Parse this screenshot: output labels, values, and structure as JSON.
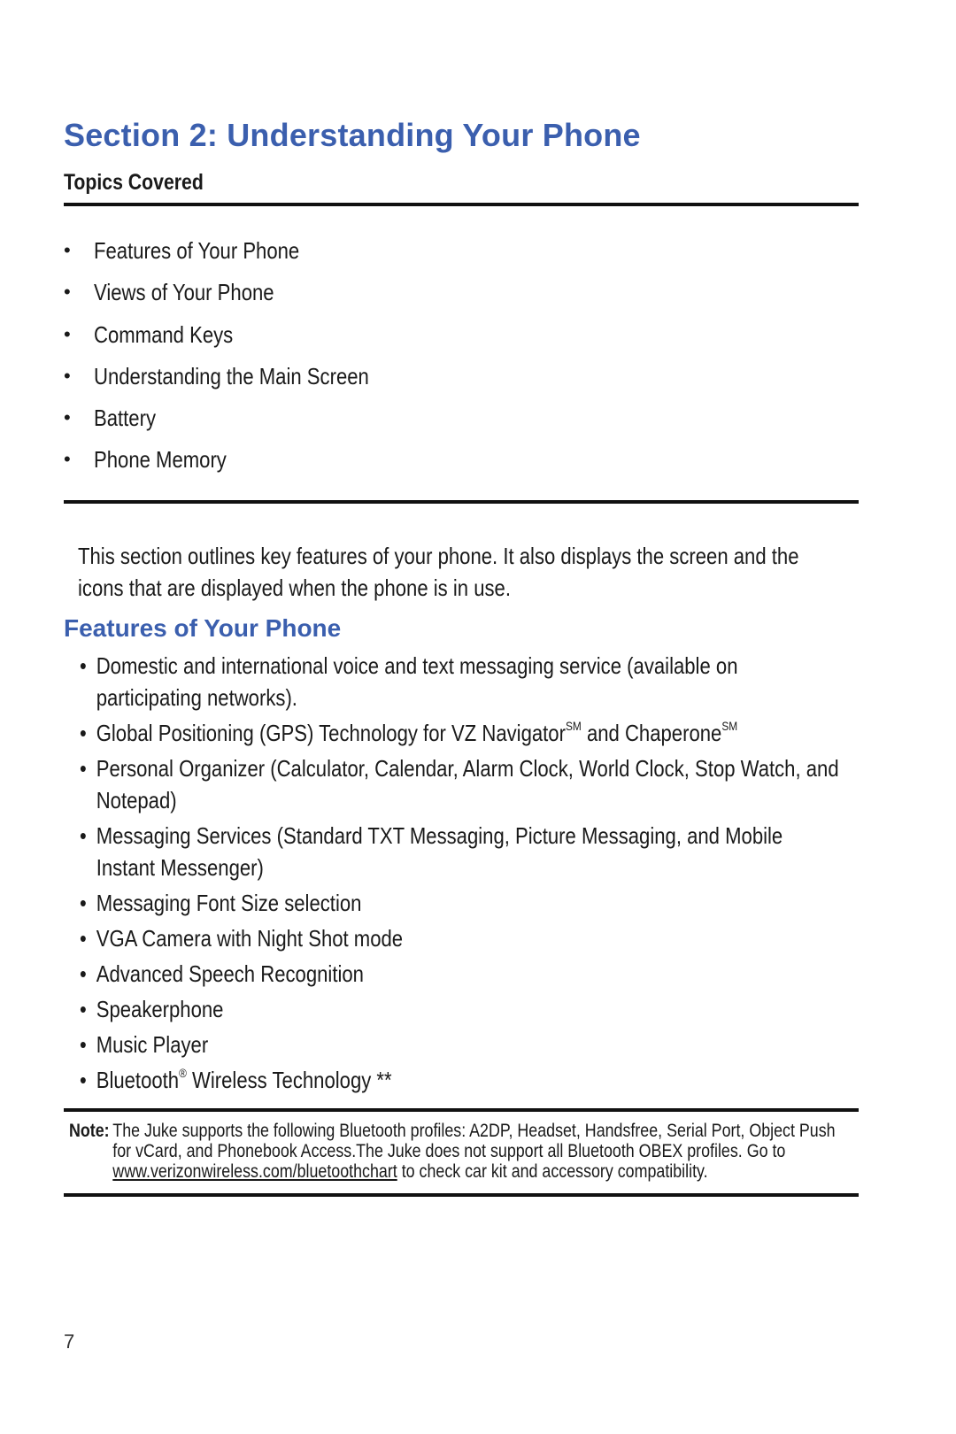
{
  "page": {
    "title": "Section 2: Understanding Your Phone",
    "number": "7",
    "accent_color": "#3b5fae"
  },
  "topics": {
    "heading": "Topics Covered",
    "bullet": "•",
    "items": [
      "Features of Your Phone",
      "Views of Your Phone",
      "Command Keys",
      "Understanding the Main Screen",
      "Battery",
      "Phone Memory"
    ]
  },
  "intro": {
    "text": "This section outlines key features of your phone. It also displays the screen and the icons that are displayed when the phone is in use."
  },
  "features": {
    "heading": "Features of Your Phone",
    "bullet": "•",
    "items": [
      {
        "text": "Domestic and international voice and text messaging service (available on participating networks)."
      },
      {
        "text": "Global Positioning (GPS) Technology for VZ Navigator",
        "sup1": "SM",
        "text2": " and Chaperone",
        "sup2": "SM"
      },
      {
        "text": "Personal Organizer (Calculator, Calendar, Alarm Clock, World Clock, Stop Watch, and Notepad)"
      },
      {
        "text": "Messaging Services (Standard TXT Messaging, Picture Messaging, and Mobile Instant Messenger)"
      },
      {
        "text": "Messaging Font Size selection"
      },
      {
        "text": "VGA Camera with Night Shot mode"
      },
      {
        "text": "Advanced Speech Recognition"
      },
      {
        "text": "Speakerphone"
      },
      {
        "text": "Music Player"
      },
      {
        "text": "Bluetooth",
        "sup1": "®",
        "text2": " Wireless Technology **"
      }
    ]
  },
  "note": {
    "label": "Note:",
    "text_before": "The Juke supports the following Bluetooth profiles: A2DP, Headset, Handsfree, Serial Port, Object Push for vCard, and Phonebook Access.The Juke does not support all Bluetooth OBEX profiles. Go to ",
    "link": "www.verizonwireless.com/bluetoothchart",
    "text_after": " to check car kit and accessory compatibility."
  }
}
